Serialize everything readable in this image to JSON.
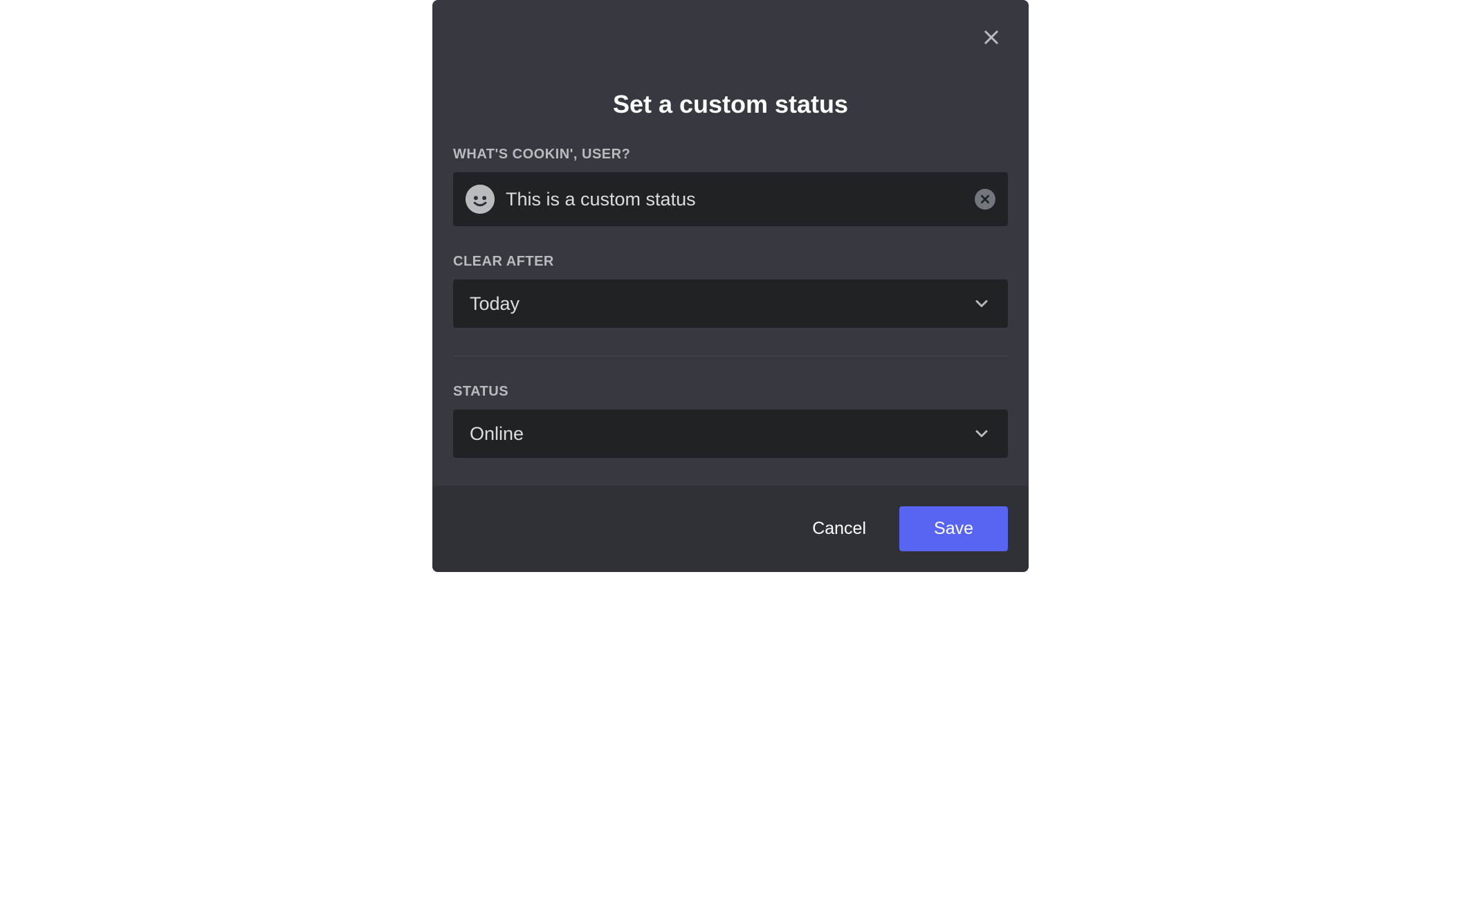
{
  "modal": {
    "title": "Set a custom status",
    "status_field": {
      "label": "WHAT'S COOKIN', USER?",
      "value": "This is a custom status"
    },
    "clear_after": {
      "label": "CLEAR AFTER",
      "selected": "Today"
    },
    "status": {
      "label": "STATUS",
      "selected": "Online"
    },
    "footer": {
      "cancel_label": "Cancel",
      "save_label": "Save"
    }
  }
}
